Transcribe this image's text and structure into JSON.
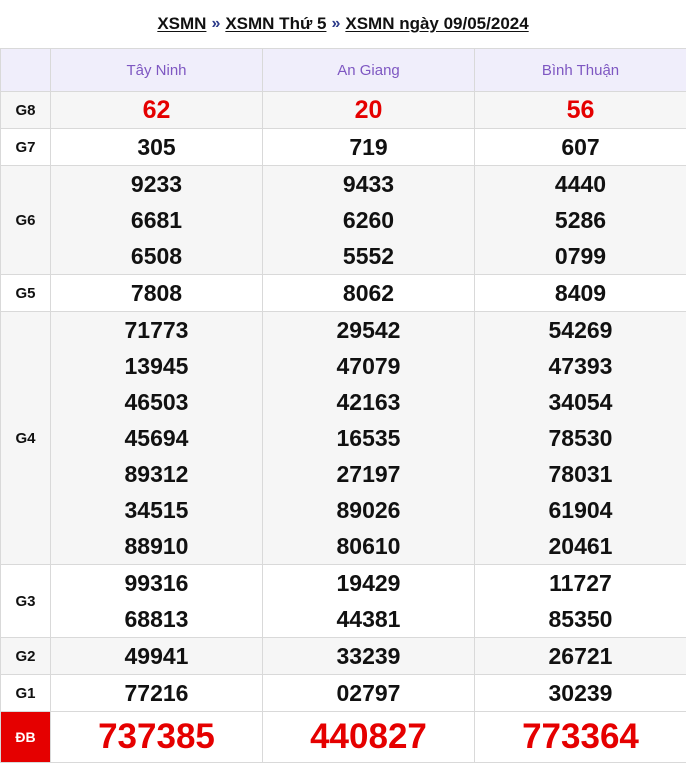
{
  "breadcrumb": {
    "items": [
      "XSMN",
      "XSMN Thứ 5",
      "XSMN ngày 09/05/2024"
    ],
    "separator": "»"
  },
  "provinces": [
    "Tây Ninh",
    "An Giang",
    "Bình Thuận"
  ],
  "prizes": [
    {
      "label": "G8",
      "results": [
        [
          "62"
        ],
        [
          "20"
        ],
        [
          "56"
        ]
      ]
    },
    {
      "label": "G7",
      "results": [
        [
          "305"
        ],
        [
          "719"
        ],
        [
          "607"
        ]
      ]
    },
    {
      "label": "G6",
      "results": [
        [
          "9233",
          "6681",
          "6508"
        ],
        [
          "9433",
          "6260",
          "5552"
        ],
        [
          "4440",
          "5286",
          "0799"
        ]
      ]
    },
    {
      "label": "G5",
      "results": [
        [
          "7808"
        ],
        [
          "8062"
        ],
        [
          "8409"
        ]
      ]
    },
    {
      "label": "G4",
      "results": [
        [
          "71773",
          "13945",
          "46503",
          "45694",
          "89312",
          "34515",
          "88910"
        ],
        [
          "29542",
          "47079",
          "42163",
          "16535",
          "27197",
          "89026",
          "80610"
        ],
        [
          "54269",
          "47393",
          "34054",
          "78530",
          "78031",
          "61904",
          "20461"
        ]
      ]
    },
    {
      "label": "G3",
      "results": [
        [
          "99316",
          "68813"
        ],
        [
          "19429",
          "44381"
        ],
        [
          "11727",
          "85350"
        ]
      ]
    },
    {
      "label": "G2",
      "results": [
        [
          "49941"
        ],
        [
          "33239"
        ],
        [
          "26721"
        ]
      ]
    },
    {
      "label": "G1",
      "results": [
        [
          "77216"
        ],
        [
          "02797"
        ],
        [
          "30239"
        ]
      ]
    },
    {
      "label": "ĐB",
      "results": [
        [
          "737385"
        ],
        [
          "440827"
        ],
        [
          "773364"
        ]
      ]
    }
  ],
  "colors": {
    "header_bg": "#f0eefb",
    "province_text": "#7e57c2",
    "highlight_red": "#e50000",
    "alt_row_bg": "#f6f6f6"
  }
}
